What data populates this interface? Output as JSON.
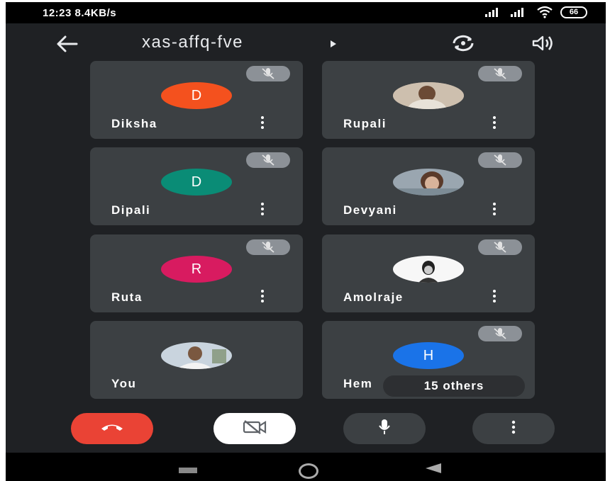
{
  "status_bar": {
    "time": "12:23",
    "net_speed": "8.4KB/s",
    "battery": "66",
    "icons": [
      "signal-icon",
      "signal-icon",
      "wifi-icon",
      "battery-icon"
    ]
  },
  "header": {
    "meeting_code": "xas-affq-fve",
    "icons": [
      "back-arrow-icon",
      "play-icon",
      "switch-camera-icon",
      "speaker-icon"
    ]
  },
  "participants": [
    {
      "name": "Diksha",
      "initial": "D",
      "color": "#f4511e",
      "muted": true
    },
    {
      "name": "Rupali",
      "initial": "",
      "color": "#bfae9c",
      "muted": true
    },
    {
      "name": "Dipali",
      "initial": "D",
      "color": "#0a8c76",
      "muted": true
    },
    {
      "name": "Devyani",
      "initial": "",
      "color": "#8f9aa5",
      "muted": true
    },
    {
      "name": "Ruta",
      "initial": "R",
      "color": "#d81b60",
      "muted": true
    },
    {
      "name": "Amolraje",
      "initial": "",
      "color": "#f2f2f2",
      "muted": true
    },
    {
      "name": "You",
      "initial": "",
      "color": "#aab6c4",
      "muted": false
    },
    {
      "name": "Hem",
      "initial": "H",
      "color": "#1a73e8",
      "muted": true
    }
  ],
  "others_count": "15 others",
  "controls": {
    "icons": [
      "end-call-icon",
      "camera-off-icon",
      "microphone-icon",
      "more-options-icon"
    ],
    "colors": {
      "end_call": "#ea4335",
      "camera": "#ffffff",
      "dark": "#3c4043"
    }
  },
  "nav_bar": {
    "icons": [
      "recents-icon",
      "home-icon",
      "nav-back-icon"
    ]
  }
}
